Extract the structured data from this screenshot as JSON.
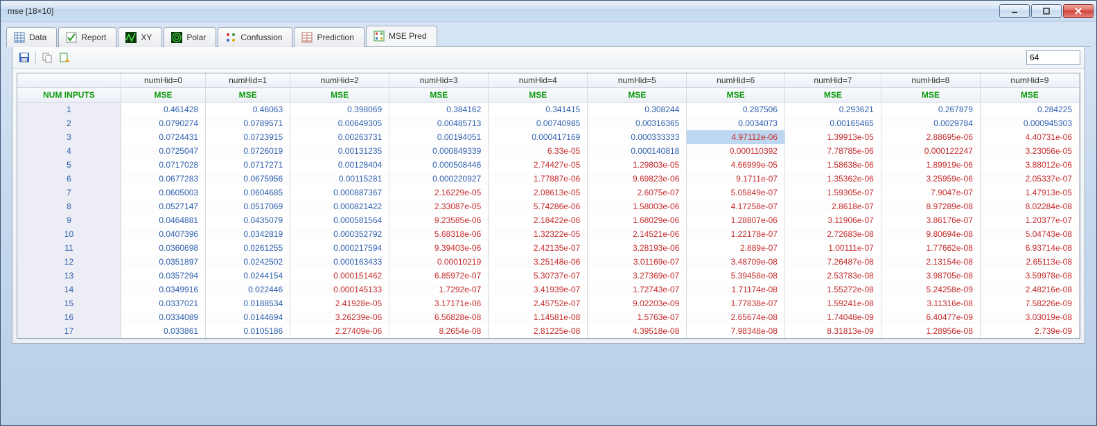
{
  "window": {
    "title": "mse [18×10]"
  },
  "tabs": [
    {
      "label": "Data"
    },
    {
      "label": "Report"
    },
    {
      "label": "XY"
    },
    {
      "label": "Polar"
    },
    {
      "label": "Confussion"
    },
    {
      "label": "Prediction"
    },
    {
      "label": "MSE Pred"
    }
  ],
  "activeTab": 6,
  "toolbar": {
    "input_value": "64"
  },
  "table": {
    "corner_label": "NUM INPUTS",
    "sub_label": "MSE",
    "top_headers": [
      "numHid=0",
      "numHid=1",
      "numHid=2",
      "numHid=3",
      "numHid=4",
      "numHid=5",
      "numHid=6",
      "numHid=7",
      "numHid=8",
      "numHid=9"
    ],
    "row_labels": [
      "1",
      "2",
      "3",
      "4",
      "5",
      "6",
      "7",
      "8",
      "9",
      "10",
      "11",
      "12",
      "13",
      "14",
      "15",
      "16",
      "17"
    ],
    "cells": [
      [
        {
          "v": "0.461428",
          "c": "b"
        },
        {
          "v": "0.46063",
          "c": "b"
        },
        {
          "v": "0.398069",
          "c": "b"
        },
        {
          "v": "0.384162",
          "c": "b"
        },
        {
          "v": "0.341415",
          "c": "b"
        },
        {
          "v": "0.308244",
          "c": "b"
        },
        {
          "v": "0.287506",
          "c": "b"
        },
        {
          "v": "0.293621",
          "c": "b"
        },
        {
          "v": "0.267879",
          "c": "b"
        },
        {
          "v": "0.284225",
          "c": "b"
        }
      ],
      [
        {
          "v": "0.0790274",
          "c": "b"
        },
        {
          "v": "0.0789571",
          "c": "b"
        },
        {
          "v": "0.00649305",
          "c": "b"
        },
        {
          "v": "0.00485713",
          "c": "b"
        },
        {
          "v": "0.00740985",
          "c": "b"
        },
        {
          "v": "0.00316365",
          "c": "b"
        },
        {
          "v": "0.0034073",
          "c": "b"
        },
        {
          "v": "0.00165465",
          "c": "b"
        },
        {
          "v": "0.0029784",
          "c": "b"
        },
        {
          "v": "0.000945303",
          "c": "b"
        }
      ],
      [
        {
          "v": "0.0724431",
          "c": "b"
        },
        {
          "v": "0.0723915",
          "c": "b"
        },
        {
          "v": "0.00263731",
          "c": "b"
        },
        {
          "v": "0.00194051",
          "c": "b"
        },
        {
          "v": "0.000417169",
          "c": "b"
        },
        {
          "v": "0.000333333",
          "c": "b"
        },
        {
          "v": "4.97112e-06",
          "c": "r",
          "hl": true
        },
        {
          "v": "1.39913e-05",
          "c": "r"
        },
        {
          "v": "2.88695e-06",
          "c": "r"
        },
        {
          "v": "4.40731e-06",
          "c": "r"
        }
      ],
      [
        {
          "v": "0.0725047",
          "c": "b"
        },
        {
          "v": "0.0726019",
          "c": "b"
        },
        {
          "v": "0.00131235",
          "c": "b"
        },
        {
          "v": "0.000849339",
          "c": "b"
        },
        {
          "v": "6.33e-05",
          "c": "r"
        },
        {
          "v": "0.000140818",
          "c": "b"
        },
        {
          "v": "0.000110392",
          "c": "r"
        },
        {
          "v": "7.78785e-06",
          "c": "r"
        },
        {
          "v": "0.000122247",
          "c": "r"
        },
        {
          "v": "3.23056e-05",
          "c": "r"
        }
      ],
      [
        {
          "v": "0.0717028",
          "c": "b"
        },
        {
          "v": "0.0717271",
          "c": "b"
        },
        {
          "v": "0.00128404",
          "c": "b"
        },
        {
          "v": "0.000508446",
          "c": "b"
        },
        {
          "v": "2.74427e-05",
          "c": "r"
        },
        {
          "v": "1.29803e-05",
          "c": "r"
        },
        {
          "v": "4.66999e-05",
          "c": "r"
        },
        {
          "v": "1.58638e-06",
          "c": "r"
        },
        {
          "v": "1.89919e-06",
          "c": "r"
        },
        {
          "v": "3.88012e-06",
          "c": "r"
        }
      ],
      [
        {
          "v": "0.0677283",
          "c": "b"
        },
        {
          "v": "0.0675956",
          "c": "b"
        },
        {
          "v": "0.00115281",
          "c": "b"
        },
        {
          "v": "0.000220927",
          "c": "b"
        },
        {
          "v": "1.77887e-06",
          "c": "r"
        },
        {
          "v": "9.69823e-06",
          "c": "r"
        },
        {
          "v": "9.1711e-07",
          "c": "r"
        },
        {
          "v": "1.35362e-06",
          "c": "r"
        },
        {
          "v": "3.25959e-06",
          "c": "r"
        },
        {
          "v": "2.05337e-07",
          "c": "r"
        }
      ],
      [
        {
          "v": "0.0605003",
          "c": "b"
        },
        {
          "v": "0.0604685",
          "c": "b"
        },
        {
          "v": "0.000887367",
          "c": "b"
        },
        {
          "v": "2.16229e-05",
          "c": "r"
        },
        {
          "v": "2.08613e-05",
          "c": "r"
        },
        {
          "v": "2.6075e-07",
          "c": "r"
        },
        {
          "v": "5.05849e-07",
          "c": "r"
        },
        {
          "v": "1.59305e-07",
          "c": "r"
        },
        {
          "v": "7.9047e-07",
          "c": "r"
        },
        {
          "v": "1.47913e-05",
          "c": "r"
        }
      ],
      [
        {
          "v": "0.0527147",
          "c": "b"
        },
        {
          "v": "0.0517069",
          "c": "b"
        },
        {
          "v": "0.000821422",
          "c": "b"
        },
        {
          "v": "2.33087e-05",
          "c": "r"
        },
        {
          "v": "5.74286e-06",
          "c": "r"
        },
        {
          "v": "1.58003e-06",
          "c": "r"
        },
        {
          "v": "4.17258e-07",
          "c": "r"
        },
        {
          "v": "2.8618e-07",
          "c": "r"
        },
        {
          "v": "8.97289e-08",
          "c": "r"
        },
        {
          "v": "8.02284e-08",
          "c": "r"
        }
      ],
      [
        {
          "v": "0.0464881",
          "c": "b"
        },
        {
          "v": "0.0435079",
          "c": "b"
        },
        {
          "v": "0.000581564",
          "c": "b"
        },
        {
          "v": "9.23585e-06",
          "c": "r"
        },
        {
          "v": "2.18422e-06",
          "c": "r"
        },
        {
          "v": "1.68029e-06",
          "c": "r"
        },
        {
          "v": "1.28807e-06",
          "c": "r"
        },
        {
          "v": "3.11906e-07",
          "c": "r"
        },
        {
          "v": "3.86176e-07",
          "c": "r"
        },
        {
          "v": "1.20377e-07",
          "c": "r"
        }
      ],
      [
        {
          "v": "0.0407396",
          "c": "b"
        },
        {
          "v": "0.0342819",
          "c": "b"
        },
        {
          "v": "0.000352792",
          "c": "b"
        },
        {
          "v": "5.68318e-06",
          "c": "r"
        },
        {
          "v": "1.32322e-05",
          "c": "r"
        },
        {
          "v": "2.14521e-06",
          "c": "r"
        },
        {
          "v": "1.22178e-07",
          "c": "r"
        },
        {
          "v": "2.72683e-08",
          "c": "r"
        },
        {
          "v": "9.80694e-08",
          "c": "r"
        },
        {
          "v": "5.04743e-08",
          "c": "r"
        }
      ],
      [
        {
          "v": "0.0360698",
          "c": "b"
        },
        {
          "v": "0.0261255",
          "c": "b"
        },
        {
          "v": "0.000217594",
          "c": "b"
        },
        {
          "v": "9.39403e-06",
          "c": "r"
        },
        {
          "v": "2.42135e-07",
          "c": "r"
        },
        {
          "v": "3.28193e-06",
          "c": "r"
        },
        {
          "v": "2.889e-07",
          "c": "r"
        },
        {
          "v": "1.00111e-07",
          "c": "r"
        },
        {
          "v": "1.77662e-08",
          "c": "r"
        },
        {
          "v": "6.93714e-08",
          "c": "r"
        }
      ],
      [
        {
          "v": "0.0351897",
          "c": "b"
        },
        {
          "v": "0.0242502",
          "c": "b"
        },
        {
          "v": "0.000163433",
          "c": "b"
        },
        {
          "v": "0.00010219",
          "c": "r"
        },
        {
          "v": "3.25148e-06",
          "c": "r"
        },
        {
          "v": "3.01169e-07",
          "c": "r"
        },
        {
          "v": "3.48709e-08",
          "c": "r"
        },
        {
          "v": "7.26487e-08",
          "c": "r"
        },
        {
          "v": "2.13154e-08",
          "c": "r"
        },
        {
          "v": "2.65113e-08",
          "c": "r"
        }
      ],
      [
        {
          "v": "0.0357294",
          "c": "b"
        },
        {
          "v": "0.0244154",
          "c": "b"
        },
        {
          "v": "0.000151462",
          "c": "r"
        },
        {
          "v": "6.85972e-07",
          "c": "r"
        },
        {
          "v": "5.30737e-07",
          "c": "r"
        },
        {
          "v": "3.27369e-07",
          "c": "r"
        },
        {
          "v": "5.39458e-08",
          "c": "r"
        },
        {
          "v": "2.53783e-08",
          "c": "r"
        },
        {
          "v": "3.98705e-08",
          "c": "r"
        },
        {
          "v": "3.59978e-08",
          "c": "r"
        }
      ],
      [
        {
          "v": "0.0349916",
          "c": "b"
        },
        {
          "v": "0.022446",
          "c": "b"
        },
        {
          "v": "0.000145133",
          "c": "r"
        },
        {
          "v": "1.7292e-07",
          "c": "r"
        },
        {
          "v": "3.41939e-07",
          "c": "r"
        },
        {
          "v": "1.72743e-07",
          "c": "r"
        },
        {
          "v": "1.71174e-08",
          "c": "r"
        },
        {
          "v": "1.55272e-08",
          "c": "r"
        },
        {
          "v": "5.24258e-09",
          "c": "r"
        },
        {
          "v": "2.48216e-08",
          "c": "r"
        }
      ],
      [
        {
          "v": "0.0337021",
          "c": "b"
        },
        {
          "v": "0.0188534",
          "c": "b"
        },
        {
          "v": "2.41928e-05",
          "c": "r"
        },
        {
          "v": "3.17171e-06",
          "c": "r"
        },
        {
          "v": "2.45752e-07",
          "c": "r"
        },
        {
          "v": "9.02203e-09",
          "c": "r"
        },
        {
          "v": "1.77838e-07",
          "c": "r"
        },
        {
          "v": "1.59241e-08",
          "c": "r"
        },
        {
          "v": "3.11316e-08",
          "c": "r"
        },
        {
          "v": "7.58226e-09",
          "c": "r"
        }
      ],
      [
        {
          "v": "0.0334089",
          "c": "b"
        },
        {
          "v": "0.0144694",
          "c": "b"
        },
        {
          "v": "3.26239e-06",
          "c": "r"
        },
        {
          "v": "6.56828e-08",
          "c": "r"
        },
        {
          "v": "1.14581e-08",
          "c": "r"
        },
        {
          "v": "1.5763e-07",
          "c": "r"
        },
        {
          "v": "2.65674e-08",
          "c": "r"
        },
        {
          "v": "1.74048e-09",
          "c": "r"
        },
        {
          "v": "6.40477e-09",
          "c": "r"
        },
        {
          "v": "3.03019e-08",
          "c": "r"
        }
      ],
      [
        {
          "v": "0.033861",
          "c": "b"
        },
        {
          "v": "0.0105186",
          "c": "b"
        },
        {
          "v": "2.27409e-06",
          "c": "r"
        },
        {
          "v": "8.2654e-08",
          "c": "r"
        },
        {
          "v": "2.81225e-08",
          "c": "r"
        },
        {
          "v": "4.39518e-08",
          "c": "r"
        },
        {
          "v": "7.98348e-08",
          "c": "r"
        },
        {
          "v": "8.31813e-09",
          "c": "r"
        },
        {
          "v": "1.28956e-08",
          "c": "r"
        },
        {
          "v": "2.739e-09",
          "c": "r"
        }
      ]
    ]
  }
}
